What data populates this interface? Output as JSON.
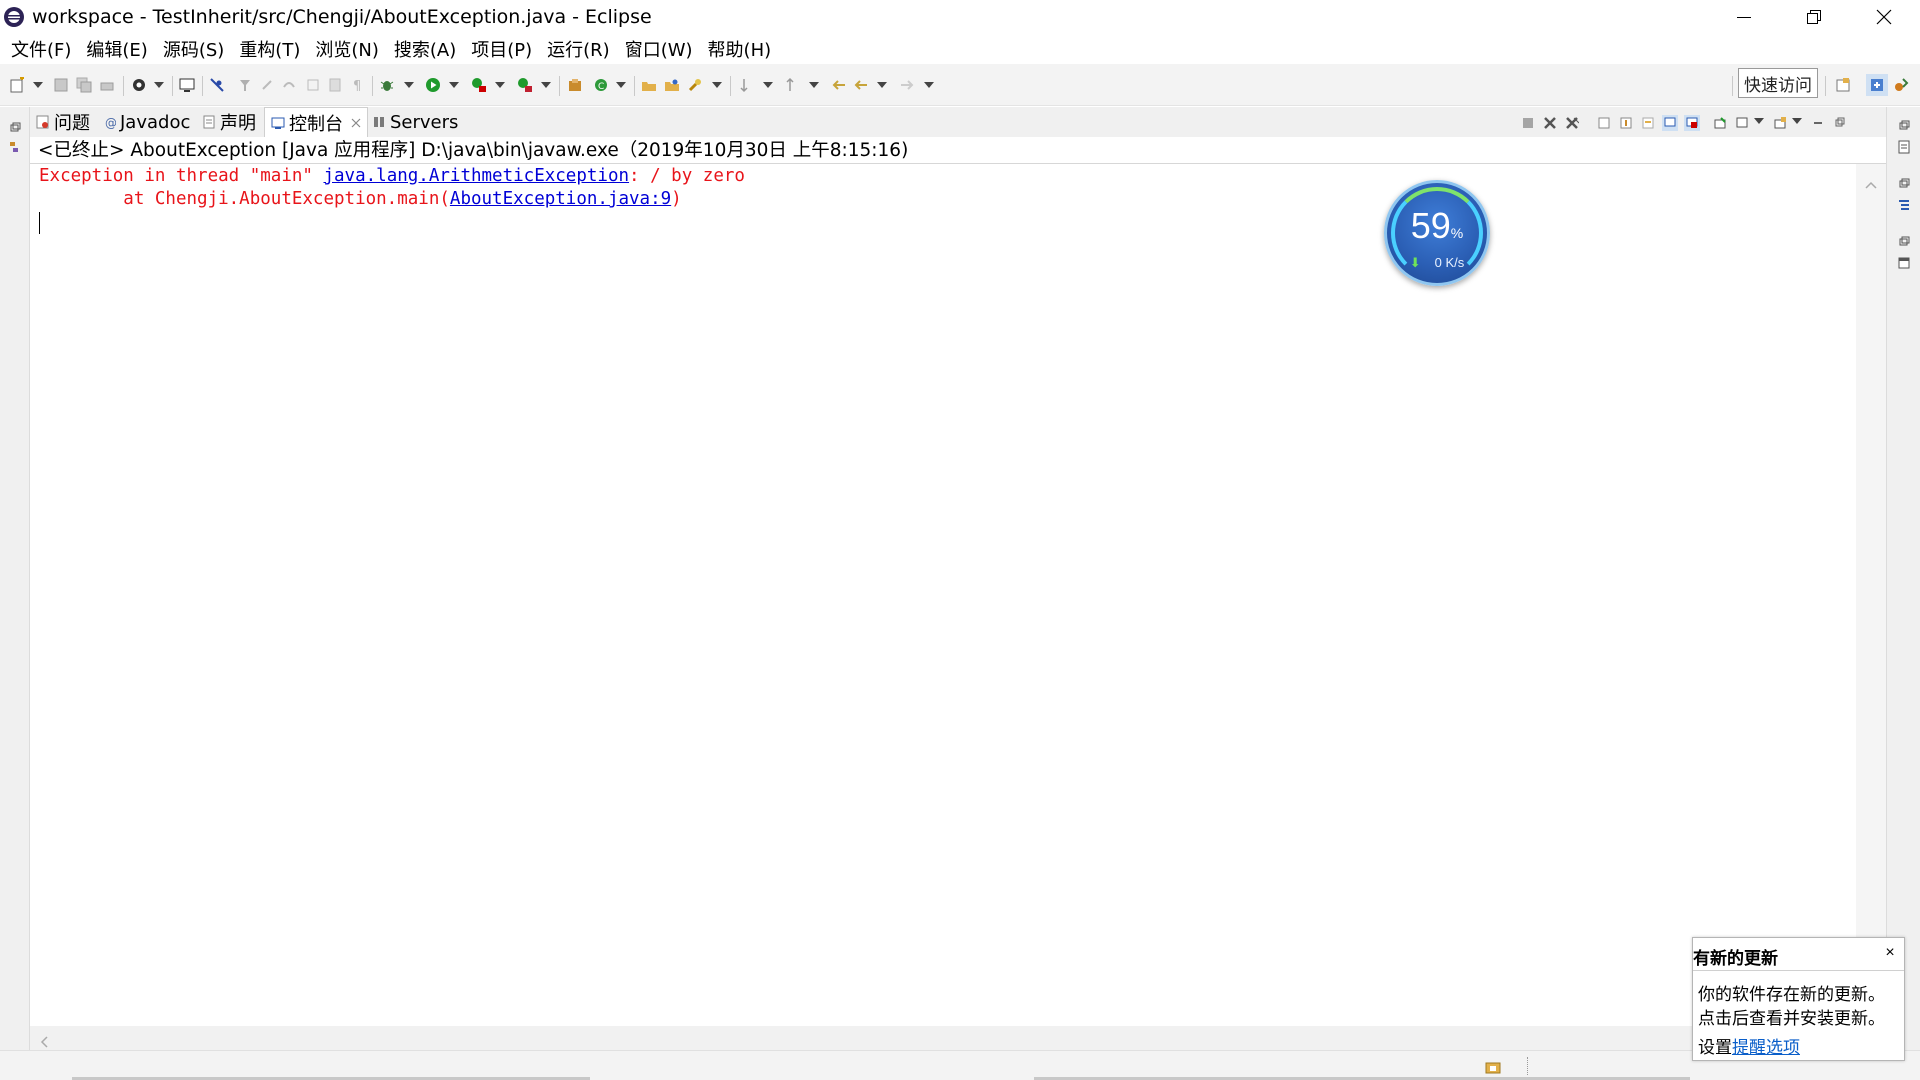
{
  "window": {
    "title": "workspace - TestInherit/src/Chengji/AboutException.java - Eclipse",
    "app_icon": "eclipse-icon",
    "controls": [
      "minimize-icon",
      "restore-icon",
      "close-icon"
    ]
  },
  "menu": {
    "items": [
      {
        "label": "文件(F)"
      },
      {
        "label": "编辑(E)"
      },
      {
        "label": "源码(S)"
      },
      {
        "label": "重构(T)"
      },
      {
        "label": "浏览(N)"
      },
      {
        "label": "搜索(A)"
      },
      {
        "label": "项目(P)"
      },
      {
        "label": "运行(R)"
      },
      {
        "label": "窗口(W)"
      },
      {
        "label": "帮助(H)"
      }
    ]
  },
  "toolbar": {
    "quick_access_label": "快速访问"
  },
  "view_tabs": {
    "items": [
      {
        "label": "问题",
        "icon": "problems-icon"
      },
      {
        "label": "Javadoc",
        "icon": "javadoc-icon"
      },
      {
        "label": "声明",
        "icon": "declaration-icon"
      },
      {
        "label": "控制台",
        "icon": "console-icon",
        "active": true
      },
      {
        "label": "Servers",
        "icon": "servers-icon"
      }
    ]
  },
  "console": {
    "header": "<已终止> AboutException [Java 应用程序] D:\\java\\bin\\javaw.exe（2019年10月30日 上午8:15:16)",
    "line1_prefix": "Exception in thread \"main\" ",
    "line1_link": "java.lang.ArithmeticException",
    "line1_suffix": ": / by zero",
    "line2_prefix": "        at Chengji.AboutException.main(",
    "line2_link": "AboutException.java:9",
    "line2_suffix": ")",
    "error_color": "#e8141a",
    "link_color": "#0000d6"
  },
  "net_widget": {
    "percent": "59",
    "percent_sign": "%",
    "speed": "0 K/s"
  },
  "update_popup": {
    "title": "有新的更新",
    "close": "×",
    "line1": "你的软件存在新的更新。",
    "line2": "点击后查看并安装更新。",
    "settings_prefix": "设置",
    "settings_link": "提醒选项"
  }
}
